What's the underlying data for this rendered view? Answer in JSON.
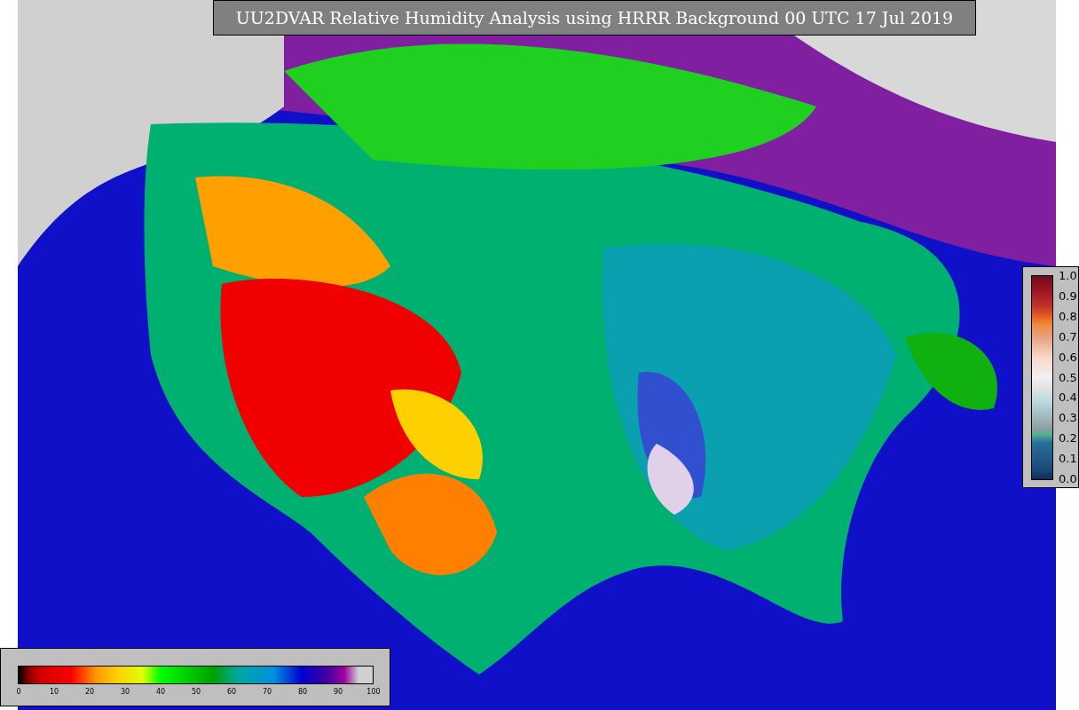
{
  "title": "UU2DVAR Relative Humidity Analysis using HRRR Background 00 UTC 17 Jul 2019",
  "humidity_colorbar": {
    "ticks": [
      "0",
      "10",
      "20",
      "30",
      "40",
      "50",
      "60",
      "70",
      "80",
      "90",
      "100"
    ]
  },
  "station_colorbar": {
    "ticks": [
      "1.0",
      "0.9",
      "0.8",
      "0.7",
      "0.6",
      "0.5",
      "0.4",
      "0.3",
      "0.2",
      "0.1",
      "0.0"
    ]
  }
}
